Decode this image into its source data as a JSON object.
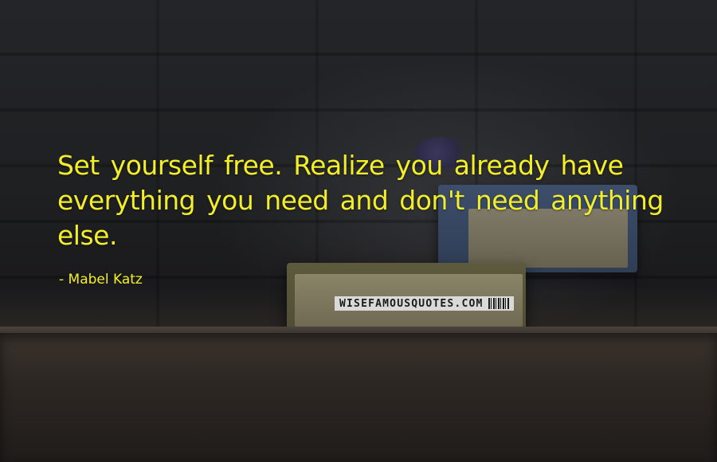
{
  "quote": {
    "text": "Set yourself free. Realize you already have everything you need and don't need anything else.",
    "author": "- Mabel Katz",
    "text_color": "#f2ee2a"
  },
  "watermark": {
    "text": "WISEFAMOUSQUOTES.COM"
  }
}
